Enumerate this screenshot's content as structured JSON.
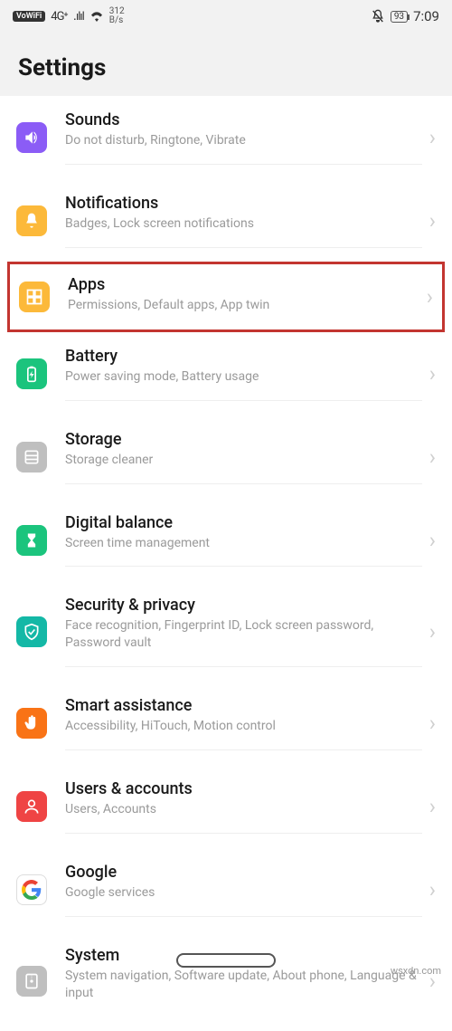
{
  "status": {
    "vowifi": "VoWiFi",
    "net": "4G⁺",
    "speed_top": "312",
    "speed_bot": "B/s",
    "battery": "93",
    "time": "7:09"
  },
  "header": {
    "title": "Settings"
  },
  "rows": [
    {
      "title": "Sounds",
      "subtitle": "Do not disturb, Ringtone, Vibrate"
    },
    {
      "title": "Notifications",
      "subtitle": "Badges, Lock screen notifications"
    },
    {
      "title": "Apps",
      "subtitle": "Permissions, Default apps, App twin"
    },
    {
      "title": "Battery",
      "subtitle": "Power saving mode, Battery usage"
    },
    {
      "title": "Storage",
      "subtitle": "Storage cleaner"
    },
    {
      "title": "Digital balance",
      "subtitle": "Screen time management"
    },
    {
      "title": "Security & privacy",
      "subtitle": "Face recognition, Fingerprint ID, Lock screen password, Password vault"
    },
    {
      "title": "Smart assistance",
      "subtitle": "Accessibility, HiTouch, Motion control"
    },
    {
      "title": "Users & accounts",
      "subtitle": "Users, Accounts"
    },
    {
      "title": "Google",
      "subtitle": "Google services"
    },
    {
      "title": "System",
      "subtitle": "System navigation, Software update, About phone, Language & input"
    }
  ],
  "watermark": "wsxdn.com"
}
